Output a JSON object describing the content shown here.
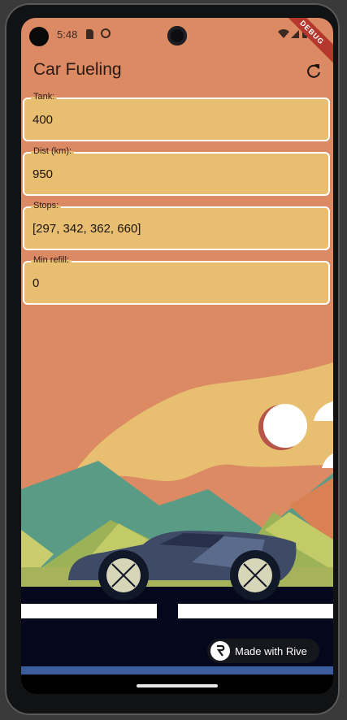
{
  "status_bar": {
    "time": "5:48"
  },
  "debug_banner": "DEBUG",
  "app_bar": {
    "title": "Car Fueling"
  },
  "fields": [
    {
      "label": "Tank:",
      "value": "400"
    },
    {
      "label": "Dist (km):",
      "value": "950"
    },
    {
      "label": "Stops:",
      "value": "[297, 342, 362, 660]"
    },
    {
      "label": "Min refill:",
      "value": "0"
    }
  ],
  "badge": {
    "text": "Made with Rive"
  },
  "colors": {
    "sky": "#db8a64",
    "field_fill": "#e8bf70",
    "road": "#05081c",
    "car": "#4a5a78"
  }
}
